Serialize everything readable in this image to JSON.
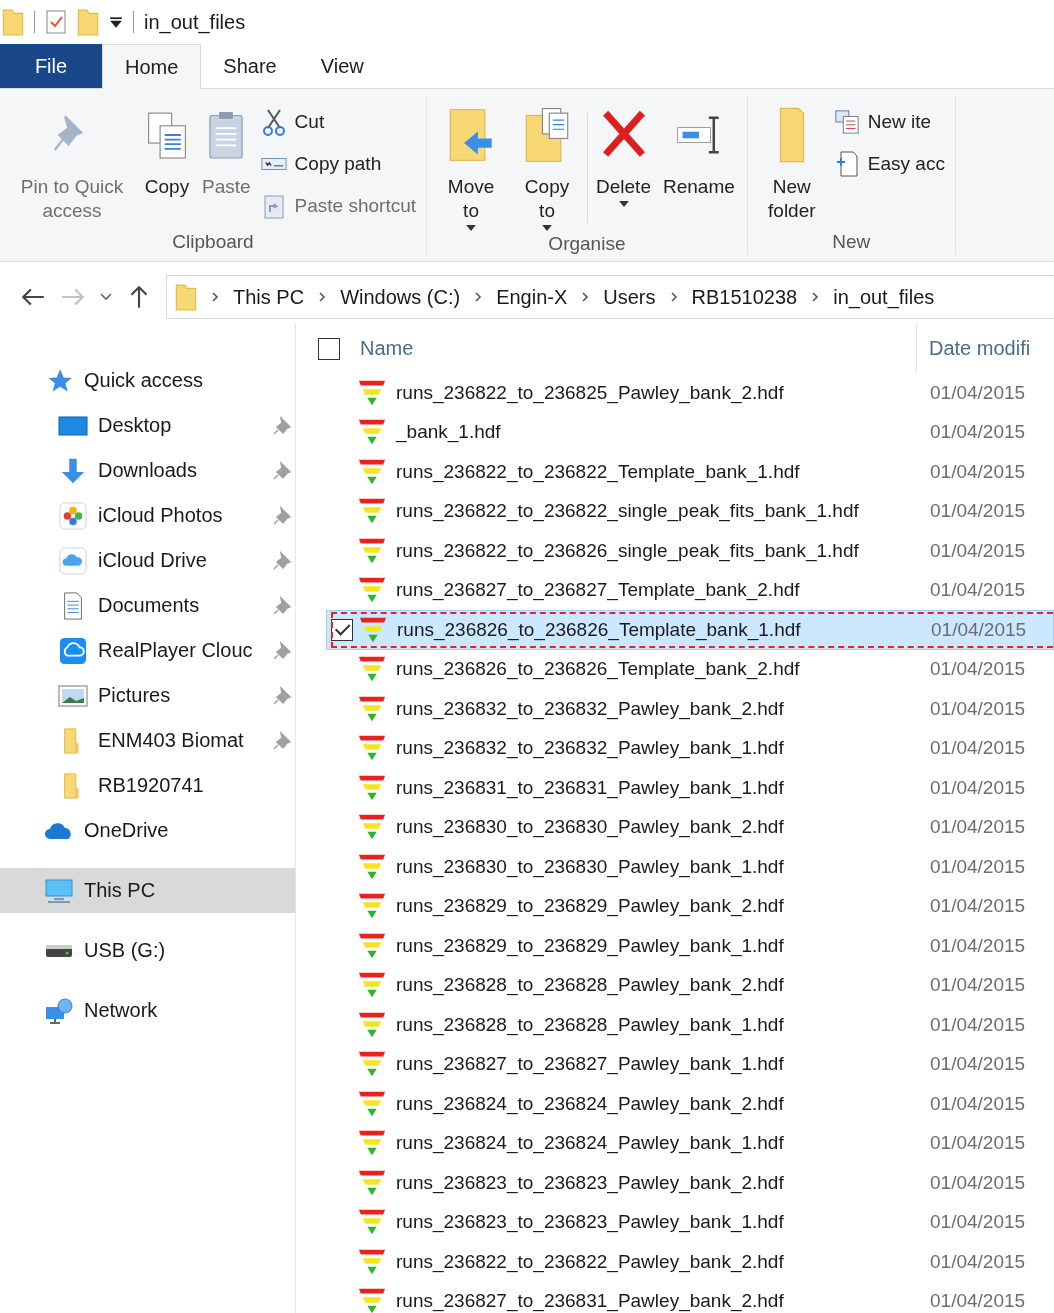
{
  "window": {
    "title": "in_out_files"
  },
  "ribbon_tabs": [
    {
      "label": "File",
      "kind": "file",
      "selected": false
    },
    {
      "label": "Home",
      "kind": "tab",
      "selected": true
    },
    {
      "label": "Share",
      "kind": "tab",
      "selected": false
    },
    {
      "label": "View",
      "kind": "tab",
      "selected": false
    }
  ],
  "ribbon_groups": [
    {
      "name": "Clipboard",
      "large": [
        {
          "label": "Pin to Quick access",
          "kind": "pin",
          "disabled": true,
          "dropdown": false
        },
        {
          "label": "Copy",
          "kind": "copy",
          "disabled": false,
          "dropdown": false
        },
        {
          "label": "Paste",
          "kind": "paste",
          "disabled": true,
          "dropdown": false
        }
      ],
      "small": [
        {
          "label": "Cut",
          "kind": "cut",
          "disabled": false
        },
        {
          "label": "Copy path",
          "kind": "path",
          "disabled": false
        },
        {
          "label": "Paste shortcut",
          "kind": "shortcut",
          "disabled": true
        }
      ]
    },
    {
      "name": "Organise",
      "large": [
        {
          "label": "Move to",
          "kind": "move",
          "disabled": false,
          "dropdown": true
        },
        {
          "label": "Copy to",
          "kind": "copyto",
          "disabled": false,
          "dropdown": true
        },
        {
          "label": "Delete",
          "kind": "delete",
          "disabled": false,
          "dropdown": true
        },
        {
          "label": "Rename",
          "kind": "rename",
          "disabled": false,
          "dropdown": false
        }
      ]
    },
    {
      "name": "New",
      "large": [
        {
          "label": "New folder",
          "kind": "folder",
          "disabled": false,
          "dropdown": false
        }
      ],
      "small": [
        {
          "label": "New ite",
          "kind": "newitem",
          "disabled": false
        },
        {
          "label": "Easy acc",
          "kind": "easy",
          "disabled": false
        }
      ]
    }
  ],
  "address_bar": {
    "segments": [
      "This PC",
      "Windows (C:)",
      "Engin-X",
      "Users",
      "RB1510238",
      "in_out_files"
    ]
  },
  "sidebar": {
    "items": [
      {
        "label": "Quick access",
        "kind": "star",
        "selected": false,
        "children": [
          {
            "label": "Desktop",
            "kind": "desktop",
            "pinned": true
          },
          {
            "label": "Downloads",
            "kind": "download",
            "pinned": true
          },
          {
            "label": "iCloud Photos",
            "kind": "photos",
            "pinned": true
          },
          {
            "label": "iCloud Drive",
            "kind": "icloud",
            "pinned": true
          },
          {
            "label": "Documents",
            "kind": "documents",
            "pinned": true
          },
          {
            "label": "RealPlayer Clouc",
            "kind": "realplayer",
            "pinned": true
          },
          {
            "label": "Pictures",
            "kind": "pictures",
            "pinned": true
          },
          {
            "label": "ENM403 Biomat",
            "kind": "folder",
            "pinned": true
          },
          {
            "label": "RB1920741",
            "kind": "folder",
            "pinned": false
          }
        ]
      },
      {
        "label": "OneDrive",
        "kind": "onedrive",
        "selected": false
      },
      {
        "label": "This PC",
        "kind": "pc",
        "selected": true
      },
      {
        "label": "USB (G:)",
        "kind": "usb",
        "selected": false
      },
      {
        "label": "Network",
        "kind": "network",
        "selected": false
      }
    ]
  },
  "file_list": {
    "columns": [
      "Name",
      "Date modifi"
    ],
    "all_checked": false,
    "rows": [
      {
        "name": "runs_236822_to_236825_Pawley_bank_2.hdf",
        "date": "01/04/2015",
        "selected": false
      },
      {
        "name": "_bank_1.hdf",
        "date": "01/04/2015",
        "selected": false
      },
      {
        "name": "runs_236822_to_236822_Template_bank_1.hdf",
        "date": "01/04/2015",
        "selected": false
      },
      {
        "name": "runs_236822_to_236822_single_peak_fits_bank_1.hdf",
        "date": "01/04/2015",
        "selected": false
      },
      {
        "name": "runs_236822_to_236826_single_peak_fits_bank_1.hdf",
        "date": "01/04/2015",
        "selected": false
      },
      {
        "name": "runs_236827_to_236827_Template_bank_2.hdf",
        "date": "01/04/2015",
        "selected": false
      },
      {
        "name": "runs_236826_to_236826_Template_bank_1.hdf",
        "date": "01/04/2015",
        "selected": true
      },
      {
        "name": "runs_236826_to_236826_Template_bank_2.hdf",
        "date": "01/04/2015",
        "selected": false
      },
      {
        "name": "runs_236832_to_236832_Pawley_bank_2.hdf",
        "date": "01/04/2015",
        "selected": false
      },
      {
        "name": "runs_236832_to_236832_Pawley_bank_1.hdf",
        "date": "01/04/2015",
        "selected": false
      },
      {
        "name": "runs_236831_to_236831_Pawley_bank_1.hdf",
        "date": "01/04/2015",
        "selected": false
      },
      {
        "name": "runs_236830_to_236830_Pawley_bank_2.hdf",
        "date": "01/04/2015",
        "selected": false
      },
      {
        "name": "runs_236830_to_236830_Pawley_bank_1.hdf",
        "date": "01/04/2015",
        "selected": false
      },
      {
        "name": "runs_236829_to_236829_Pawley_bank_2.hdf",
        "date": "01/04/2015",
        "selected": false
      },
      {
        "name": "runs_236829_to_236829_Pawley_bank_1.hdf",
        "date": "01/04/2015",
        "selected": false
      },
      {
        "name": "runs_236828_to_236828_Pawley_bank_2.hdf",
        "date": "01/04/2015",
        "selected": false
      },
      {
        "name": "runs_236828_to_236828_Pawley_bank_1.hdf",
        "date": "01/04/2015",
        "selected": false
      },
      {
        "name": "runs_236827_to_236827_Pawley_bank_1.hdf",
        "date": "01/04/2015",
        "selected": false
      },
      {
        "name": "runs_236824_to_236824_Pawley_bank_2.hdf",
        "date": "01/04/2015",
        "selected": false
      },
      {
        "name": "runs_236824_to_236824_Pawley_bank_1.hdf",
        "date": "01/04/2015",
        "selected": false
      },
      {
        "name": "runs_236823_to_236823_Pawley_bank_2.hdf",
        "date": "01/04/2015",
        "selected": false
      },
      {
        "name": "runs_236823_to_236823_Pawley_bank_1.hdf",
        "date": "01/04/2015",
        "selected": false
      },
      {
        "name": "runs_236822_to_236822_Pawley_bank_2.hdf",
        "date": "01/04/2015",
        "selected": false
      },
      {
        "name": "runs_236827_to_236831_Pawley_bank_2.hdf",
        "date": "01/04/2015",
        "selected": false
      }
    ]
  }
}
